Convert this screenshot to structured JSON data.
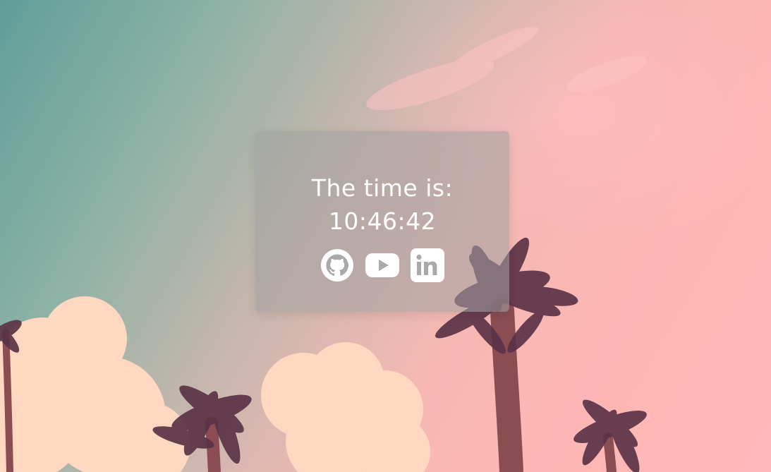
{
  "widget": {
    "label": "The time is:",
    "time": "10:46:42"
  },
  "social_links": [
    {
      "name": "github",
      "icon": "github-icon"
    },
    {
      "name": "youtube",
      "icon": "youtube-icon"
    },
    {
      "name": "linkedin",
      "icon": "linkedin-icon"
    }
  ],
  "colors": {
    "sky_left": "#5f9e98",
    "sky_right": "#ffb7b6",
    "card": "#a0a0a0",
    "text": "#ffffff"
  }
}
